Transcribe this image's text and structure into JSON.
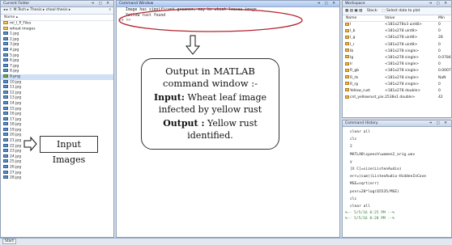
{
  "current_folder": {
    "title": "Current Folder",
    "path": [
      "M.Tech",
      "Thesis",
      "chool thesis"
    ],
    "column_header": "Name",
    "items": [
      {
        "name": "ml_I_P_Files",
        "kind": "folder"
      },
      {
        "name": "wheat images",
        "kind": "folder"
      },
      {
        "name": "1.jpg",
        "kind": "image"
      },
      {
        "name": "2.jpg",
        "kind": "image"
      },
      {
        "name": "3.jpg",
        "kind": "image"
      },
      {
        "name": "4.jpg",
        "kind": "image"
      },
      {
        "name": "5.jpg",
        "kind": "image"
      },
      {
        "name": "6.jpg",
        "kind": "image"
      },
      {
        "name": "7.jpg",
        "kind": "image"
      },
      {
        "name": "8.jpg",
        "kind": "image"
      },
      {
        "name": "9.png",
        "kind": "mat"
      },
      {
        "name": "10.jpg",
        "kind": "image"
      },
      {
        "name": "11.jpg",
        "kind": "image"
      },
      {
        "name": "12.jpg",
        "kind": "image"
      },
      {
        "name": "13.jpg",
        "kind": "image"
      },
      {
        "name": "14.jpg",
        "kind": "image"
      },
      {
        "name": "15.jpg",
        "kind": "image"
      },
      {
        "name": "16.jpg",
        "kind": "image"
      },
      {
        "name": "17.jpg",
        "kind": "image"
      },
      {
        "name": "18.jpg",
        "kind": "image"
      },
      {
        "name": "19.jpg",
        "kind": "image"
      },
      {
        "name": "20.jpg",
        "kind": "image"
      },
      {
        "name": "21.jpg",
        "kind": "image"
      },
      {
        "name": "22.jpg",
        "kind": "image"
      },
      {
        "name": "23.jpg",
        "kind": "image"
      },
      {
        "name": "24.jpg",
        "kind": "image"
      },
      {
        "name": "25.jpg",
        "kind": "image"
      },
      {
        "name": "26.jpg",
        "kind": "image"
      },
      {
        "name": "27.jpg",
        "kind": "image"
      },
      {
        "name": "28.jpg",
        "kind": "image"
      }
    ]
  },
  "command_window": {
    "title": "Command Window",
    "lines": [
      "Image has significant greenes, may be wheat leaves image",
      "Yellow rust found"
    ],
    "prompt": "fx >>"
  },
  "workspace": {
    "title": "Workspace",
    "toolbar_stack": "Stack:",
    "toolbar_select": "Select data to plot",
    "headers": [
      "Name",
      "Value",
      "Min"
    ],
    "rows": [
      [
        "I",
        "<181x278x3 uint8>",
        "0"
      ],
      [
        "I_b",
        "<181x278 uint8>",
        "0"
      ],
      [
        "I_g",
        "<181x278 uint8>",
        "28"
      ],
      [
        "I_r",
        "<181x278 uint8>",
        "0"
      ],
      [
        "Ib",
        "<181x278 single>",
        "0"
      ],
      [
        "Ig",
        "<181x278 single>",
        "0.0784"
      ],
      [
        "Ir",
        "<181x278 single>",
        "0"
      ],
      [
        "R_gb",
        "<181x278 single>",
        "0.0007"
      ],
      [
        "R_rb",
        "<181x278 single>",
        "NaN"
      ],
      [
        "R_rg",
        "<181x278 single>",
        "0"
      ],
      [
        "Yellow_rust",
        "<181x278 double>",
        "0"
      ],
      [
        "cnt_yellowrust_pix...",
        "2538x1 double>",
        "42"
      ]
    ]
  },
  "command_history": {
    "title": "Command History",
    "lines": [
      "clear all",
      "clc",
      "2",
      "MATLAB\\speech\\women2_orig.wav",
      "y",
      "[X C]=size(ListenAudio)",
      "err=(sum((ListenAudio-HiddenInCove",
      "MSE=sqrt(err)",
      "psnr=20*log(65535/MSE)",
      "clc",
      "clear all"
    ],
    "sessions": [
      "%-- 5/5/16  8:25 PM --%",
      "%-- 5/5/16  8:28 PM --%"
    ]
  },
  "annotations": {
    "output_title": "Output in MATLAB command window :-",
    "input_label": "Input:",
    "input_text": "Wheat leaf image infected by yellow rust",
    "output_label": "Output :",
    "output_text": "Yellow rust identified.",
    "input_images": "Input Images"
  },
  "status_bar": {
    "start": "Start"
  }
}
